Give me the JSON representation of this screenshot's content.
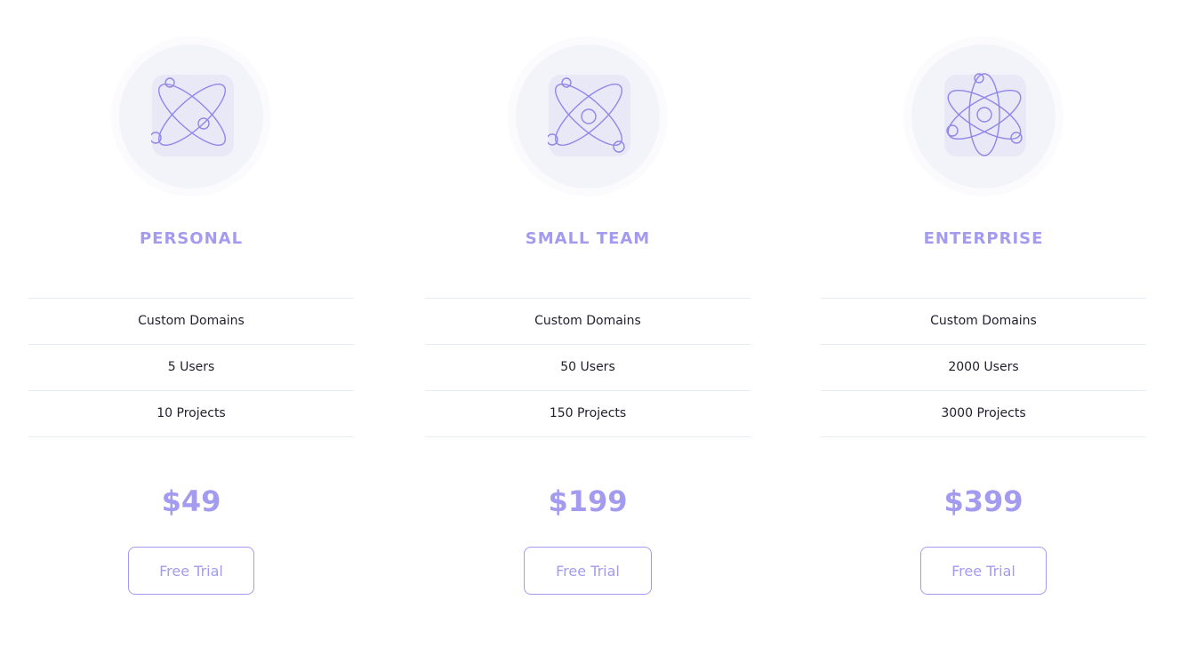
{
  "plans": [
    {
      "name": "PERSONAL",
      "icon": "atom-icon",
      "features": [
        "Custom Domains",
        "5 Users",
        "10 Projects"
      ],
      "price": "$49",
      "cta": "Free Trial"
    },
    {
      "name": "SMALL TEAM",
      "icon": "atom-icon",
      "features": [
        "Custom Domains",
        "50 Users",
        "150 Projects"
      ],
      "price": "$199",
      "cta": "Free Trial"
    },
    {
      "name": "ENTERPRISE",
      "icon": "atom-icon",
      "features": [
        "Custom Domains",
        "2000 Users",
        "3000 Projects"
      ],
      "price": "$399",
      "cta": "Free Trial"
    }
  ],
  "colors": {
    "accent": "#a39bf0",
    "divider": "#e3eef3",
    "icon_circle": "#f3f3fa",
    "text": "#1f1f2e"
  }
}
